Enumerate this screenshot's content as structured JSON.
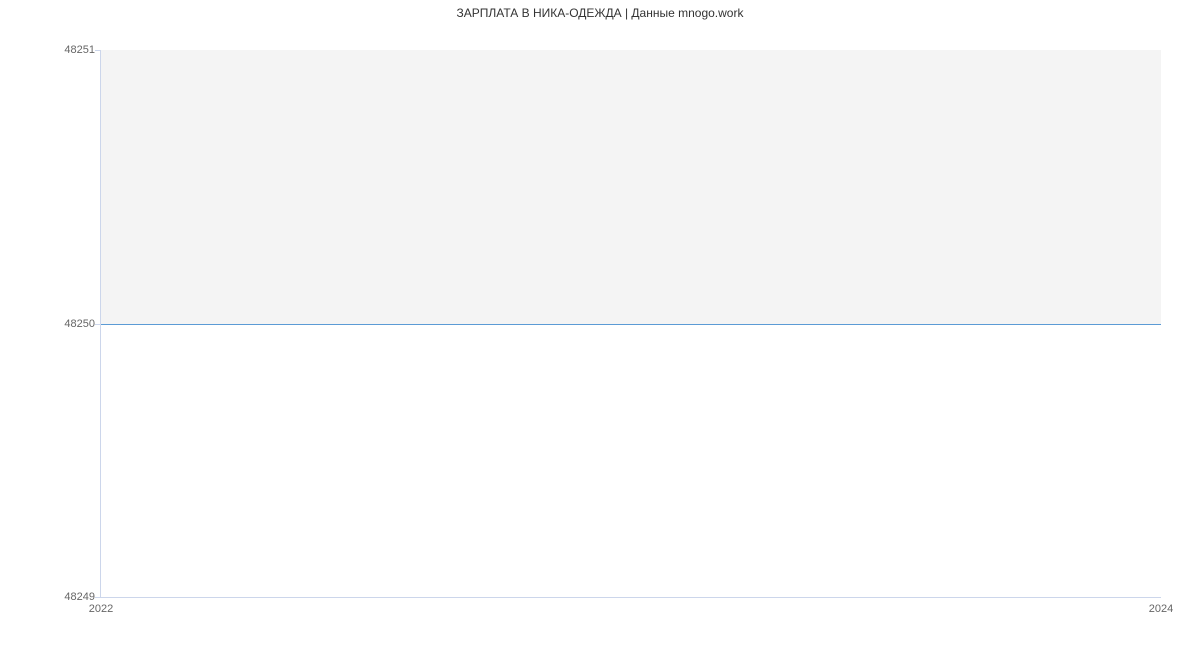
{
  "chart_data": {
    "type": "line",
    "title": "ЗАРПЛАТА В НИКА-ОДЕЖДА | Данные mnogo.work",
    "x": [
      2022,
      2024
    ],
    "series": [
      {
        "name": "salary",
        "values": [
          48250,
          48250
        ],
        "color": "#5b9bd5"
      }
    ],
    "x_ticks": [
      2022,
      2024
    ],
    "y_ticks": [
      48249,
      48250,
      48251
    ],
    "xlim": [
      2022,
      2024
    ],
    "ylim": [
      48249,
      48251
    ],
    "xlabel": "",
    "ylabel": ""
  }
}
